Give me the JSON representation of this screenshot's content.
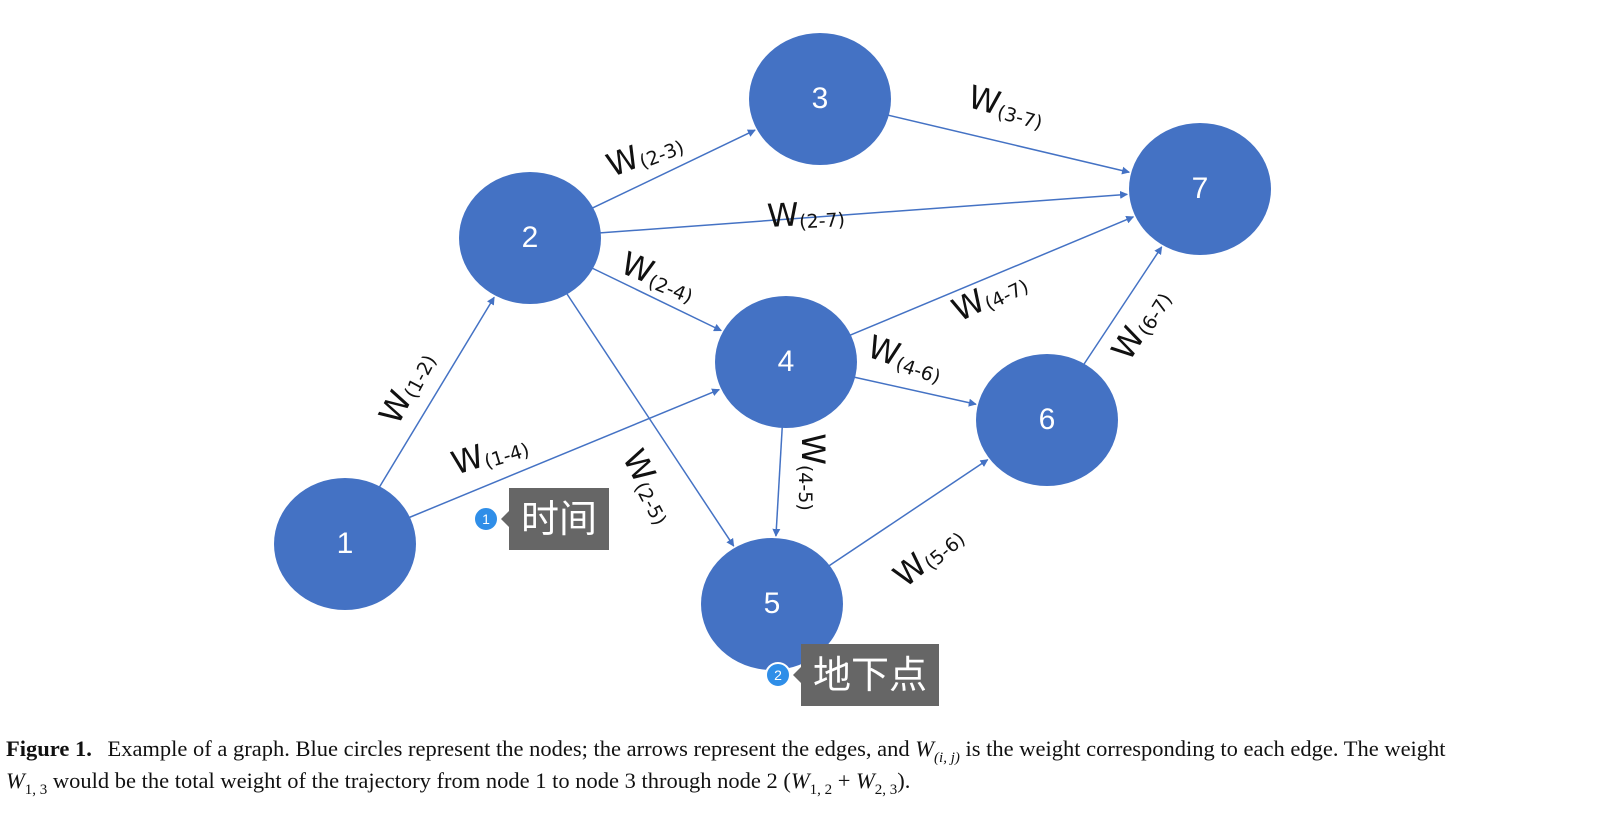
{
  "nodes": [
    {
      "id": "1",
      "label": "1"
    },
    {
      "id": "2",
      "label": "2"
    },
    {
      "id": "3",
      "label": "3"
    },
    {
      "id": "4",
      "label": "4"
    },
    {
      "id": "5",
      "label": "5"
    },
    {
      "id": "6",
      "label": "6"
    },
    {
      "id": "7",
      "label": "7"
    }
  ],
  "edges": [
    {
      "from": "1",
      "to": "2",
      "label_main": "W",
      "label_sub": "(1-2)"
    },
    {
      "from": "1",
      "to": "4",
      "label_main": "W",
      "label_sub": "(1-4)"
    },
    {
      "from": "2",
      "to": "3",
      "label_main": "W",
      "label_sub": "(2-3)"
    },
    {
      "from": "2",
      "to": "7",
      "label_main": "W",
      "label_sub": "(2-7)"
    },
    {
      "from": "2",
      "to": "4",
      "label_main": "W",
      "label_sub": "(2-4)"
    },
    {
      "from": "2",
      "to": "5",
      "label_main": "W",
      "label_sub": "(2-5)"
    },
    {
      "from": "3",
      "to": "7",
      "label_main": "W",
      "label_sub": "(3-7)"
    },
    {
      "from": "4",
      "to": "7",
      "label_main": "W",
      "label_sub": "(4-7)"
    },
    {
      "from": "4",
      "to": "6",
      "label_main": "W",
      "label_sub": "(4-6)"
    },
    {
      "from": "4",
      "to": "5",
      "label_main": "W",
      "label_sub": "(4-5)"
    },
    {
      "from": "5",
      "to": "6",
      "label_main": "W",
      "label_sub": "(5-6)"
    },
    {
      "from": "6",
      "to": "7",
      "label_main": "W",
      "label_sub": "(6-7)"
    }
  ],
  "annotations": [
    {
      "number": "1",
      "text": "时间"
    },
    {
      "number": "2",
      "text": "地下点"
    }
  ],
  "caption": {
    "figure_label": "Figure 1.",
    "text_part1": "Example of a graph. Blue circles represent the nodes; the arrows represent the edges, and",
    "w_symbol": "W",
    "w_sub": "(i, j)",
    "text_part2": "is the weight corresponding to each edge. The weight",
    "w13_sub": "1, 3",
    "text_part3": "would be the total weight of the trajectory from node 1 to node 3 through node 2 (",
    "w12_sub": "1, 2",
    "plus": "+",
    "w23_sub": "2, 3",
    "text_part4": ")."
  },
  "colors": {
    "node_fill": "#4472C4",
    "edge_stroke": "#4472C4",
    "node_text": "#ffffff",
    "annotation_box": "#666666",
    "annotation_dot": "#2f8ee8"
  }
}
